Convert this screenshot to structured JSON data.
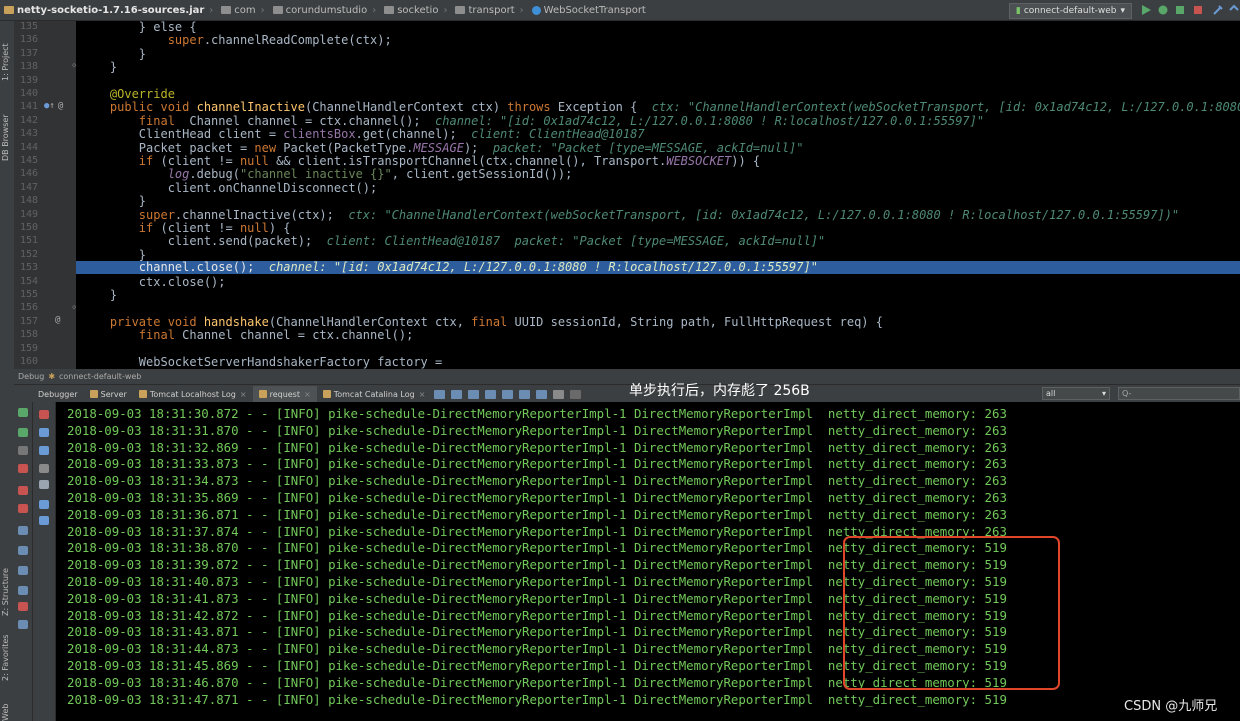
{
  "breadcrumbs": [
    "netty-socketio-1.7.16-sources.jar",
    "com",
    "corundumstudio",
    "socketio",
    "transport",
    "WebSocketTransport"
  ],
  "run_config": "connect-default-web",
  "left_panels": [
    "1: Project",
    "DB Browser",
    "Z: Structure",
    "2: Favorites",
    "Web"
  ],
  "line_numbers": [
    "135",
    "136",
    "137",
    "138",
    "139",
    "140",
    "141",
    "142",
    "143",
    "144",
    "145",
    "146",
    "147",
    "148",
    "149",
    "150",
    "151",
    "152",
    "153",
    "154",
    "155",
    "156",
    "157",
    "158",
    "159",
    "160"
  ],
  "code": {
    "l135": "        } else {",
    "l136_super": "super",
    "l136_rest": ".channelReadComplete(ctx);",
    "l137": "        }",
    "l138": "    }",
    "l140_annotation": "@Override",
    "l141_kw": "public void ",
    "l141_fn": "channelInactive",
    "l141_a": "(ChannelHandlerContext ctx) ",
    "l141_throws": "throws",
    "l141_b": " Exception {",
    "l141_hint": "ctx: \"ChannelHandlerContext(webSocketTransport, [id: 0x1ad74c12, L:/127.0.0.1:8080 ! R:",
    "l142_kw": "final",
    "l142_a": "  Channel channel = ctx.channel();",
    "l142_hint": "channel: \"[id: 0x1ad74c12, L:/127.0.0.1:8080 ! R:localhost/127.0.0.1:55597]\"",
    "l143_a": "ClientHead client = ",
    "l143_field": "clientsBox",
    "l143_b": ".get(channel);",
    "l143_hint": "client: ClientHead@10187",
    "l144_a": "Packet packet = ",
    "l144_new": "new",
    "l144_b": " Packet(PacketType.",
    "l144_const": "MESSAGE",
    "l144_c": ");",
    "l144_hint": "packet: \"Packet [type=MESSAGE, ackId=null]\"",
    "l145_if": "if",
    "l145_a": " (client != ",
    "l145_null": "null",
    "l145_b": " && client.isTransportChannel(ctx.channel(), Transport.",
    "l145_const": "WEBSOCKET",
    "l145_c": ")) {",
    "l146_log": "log",
    "l146_a": ".debug(",
    "l146_str": "\"channel inactive {}\"",
    "l146_b": ", client.getSessionId());",
    "l147": "client.onChannelDisconnect();",
    "l148": "}",
    "l149_super": "super",
    "l149_a": ".channelInactive(ctx);",
    "l149_hint": "ctx: \"ChannelHandlerContext(webSocketTransport, [id: 0x1ad74c12, L:/127.0.0.1:8080 ! R:localhost/127.0.0.1:55597])\"",
    "l150_if": "if",
    "l150_a": " (client != ",
    "l150_null": "null",
    "l150_b": ") {",
    "l151_a": "client.send(packet);",
    "l151_hint": "client: ClientHead@10187  packet: \"Packet [type=MESSAGE, ackId=null]\"",
    "l152": "}",
    "l153_a": "channel.close();",
    "l153_hint": "channel: \"[id: 0x1ad74c12, L:/127.0.0.1:8080 ! R:localhost/127.0.0.1:55597]\"",
    "l154": "ctx.close();",
    "l155": "}",
    "l157_kw": "private void ",
    "l157_fn": "handshake",
    "l157_a": "(ChannelHandlerContext ctx, ",
    "l157_final": "final",
    "l157_b": " UUID sessionId, String path, FullHttpRequest req) {",
    "l158_final": "final",
    "l158_a": " Channel channel = ctx.channel();",
    "l160": "WebSocketServerHandshakerFactory factory ="
  },
  "debug": {
    "title": "Debug",
    "config": "connect-default-web",
    "tabs": [
      "Debugger",
      "Server",
      "Tomcat Localhost Log",
      "request",
      "Tomcat Catalina Log"
    ],
    "annotation": "单步执行后，内存彪了 256B",
    "filter": "all",
    "search_placeholder": "Q-"
  },
  "log_lines": [
    "2018-09-03 18:31:30.872 - - [INFO] pike-schedule-DirectMemoryReporterImpl-1 DirectMemoryReporterImpl  netty_direct_memory: 263",
    "2018-09-03 18:31:31.870 - - [INFO] pike-schedule-DirectMemoryReporterImpl-1 DirectMemoryReporterImpl  netty_direct_memory: 263",
    "2018-09-03 18:31:32.869 - - [INFO] pike-schedule-DirectMemoryReporterImpl-1 DirectMemoryReporterImpl  netty_direct_memory: 263",
    "2018-09-03 18:31:33.873 - - [INFO] pike-schedule-DirectMemoryReporterImpl-1 DirectMemoryReporterImpl  netty_direct_memory: 263",
    "2018-09-03 18:31:34.873 - - [INFO] pike-schedule-DirectMemoryReporterImpl-1 DirectMemoryReporterImpl  netty_direct_memory: 263",
    "2018-09-03 18:31:35.869 - - [INFO] pike-schedule-DirectMemoryReporterImpl-1 DirectMemoryReporterImpl  netty_direct_memory: 263",
    "2018-09-03 18:31:36.871 - - [INFO] pike-schedule-DirectMemoryReporterImpl-1 DirectMemoryReporterImpl  netty_direct_memory: 263",
    "2018-09-03 18:31:37.874 - - [INFO] pike-schedule-DirectMemoryReporterImpl-1 DirectMemoryReporterImpl  netty_direct_memory: 263",
    "2018-09-03 18:31:38.870 - - [INFO] pike-schedule-DirectMemoryReporterImpl-1 DirectMemoryReporterImpl  netty_direct_memory: 519",
    "2018-09-03 18:31:39.872 - - [INFO] pike-schedule-DirectMemoryReporterImpl-1 DirectMemoryReporterImpl  netty_direct_memory: 519",
    "2018-09-03 18:31:40.873 - - [INFO] pike-schedule-DirectMemoryReporterImpl-1 DirectMemoryReporterImpl  netty_direct_memory: 519",
    "2018-09-03 18:31:41.873 - - [INFO] pike-schedule-DirectMemoryReporterImpl-1 DirectMemoryReporterImpl  netty_direct_memory: 519",
    "2018-09-03 18:31:42.872 - - [INFO] pike-schedule-DirectMemoryReporterImpl-1 DirectMemoryReporterImpl  netty_direct_memory: 519",
    "2018-09-03 18:31:43.871 - - [INFO] pike-schedule-DirectMemoryReporterImpl-1 DirectMemoryReporterImpl  netty_direct_memory: 519",
    "2018-09-03 18:31:44.873 - - [INFO] pike-schedule-DirectMemoryReporterImpl-1 DirectMemoryReporterImpl  netty_direct_memory: 519",
    "2018-09-03 18:31:45.869 - - [INFO] pike-schedule-DirectMemoryReporterImpl-1 DirectMemoryReporterImpl  netty_direct_memory: 519",
    "2018-09-03 18:31:46.870 - - [INFO] pike-schedule-DirectMemoryReporterImpl-1 DirectMemoryReporterImpl  netty_direct_memory: 519",
    "2018-09-03 18:31:47.871 - - [INFO] pike-schedule-DirectMemoryReporterImpl-1 DirectMemoryReporterImpl  netty_direct_memory: 519"
  ],
  "watermark": "CSDN @九师兄",
  "colors": {
    "highlight": "#2d5d9c",
    "log_text": "#72c95a",
    "callout_box": "#e0462a",
    "keyword": "#cc7832"
  }
}
